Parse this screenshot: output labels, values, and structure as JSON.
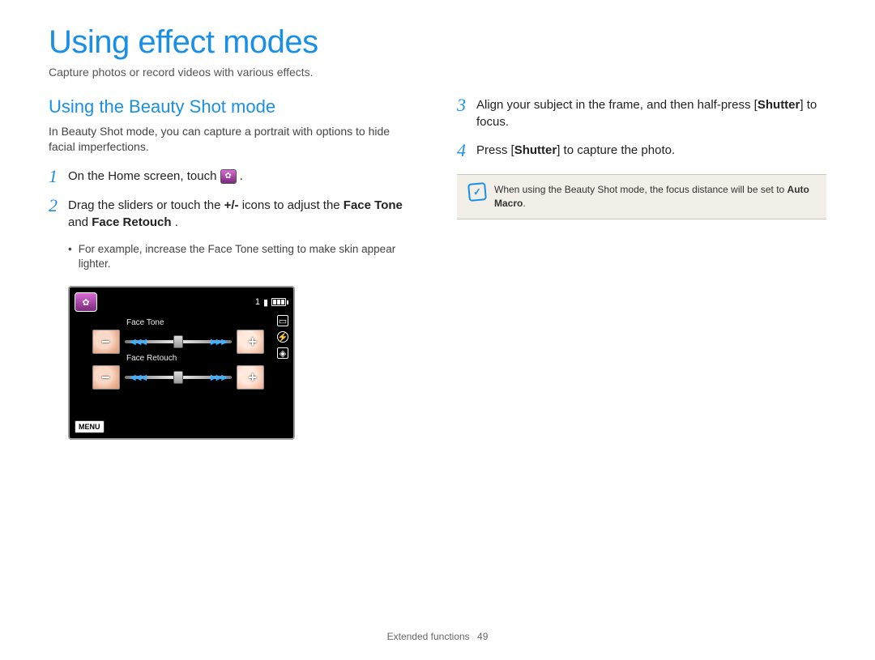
{
  "page_title": "Using effect modes",
  "page_subtitle": "Capture photos or record videos with various effects.",
  "left": {
    "section_title": "Using the Beauty Shot mode",
    "section_desc": "In Beauty Shot mode, you can capture a portrait with options to hide facial imperfections.",
    "step1": {
      "num": "1",
      "pre": "On the Home screen, touch ",
      "post": "."
    },
    "step2": {
      "num": "2",
      "pre": "Drag the sliders or touch the ",
      "plusminus": "+/-",
      "mid": " icons to adjust the ",
      "ft": "Face Tone",
      "and": " and ",
      "fr": "Face Retouch",
      "post": "."
    },
    "bullet1": "For example, increase the Face Tone setting to make skin appear lighter."
  },
  "shot": {
    "count": "1",
    "menu": "MENU",
    "slider1_label": "Face Tone",
    "slider2_label": "Face Retouch"
  },
  "right": {
    "step3": {
      "num": "3",
      "pre": "Align your subject in the frame, and then half-press [",
      "shutter": "Shutter",
      "post": "] to focus."
    },
    "step4": {
      "num": "4",
      "pre": "Press [",
      "shutter": "Shutter",
      "post": "] to capture the photo."
    },
    "note_pre": "When using the Beauty Shot mode, the focus distance will be set to ",
    "note_bold": "Auto Macro",
    "note_post": "."
  },
  "footer_label": "Extended functions",
  "footer_page": "49"
}
